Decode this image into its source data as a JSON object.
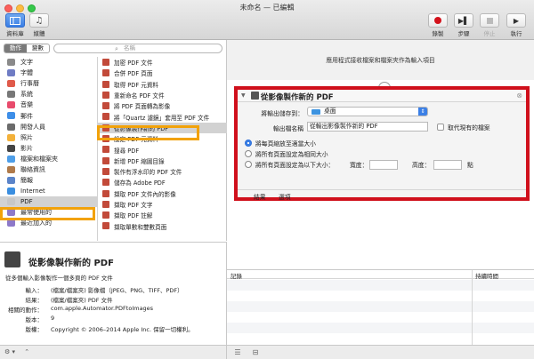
{
  "window": {
    "title": "未命名 — 已編輯"
  },
  "toolbar": {
    "library": "資料庫",
    "media": "媒體",
    "record": "錄製",
    "step": "步驟",
    "stop": "停止",
    "run": "執行"
  },
  "left": {
    "tab_actions": "動作",
    "tab_variables": "變數",
    "search_placeholder": "名稱",
    "categories": [
      {
        "label": "文字",
        "color": "#8a8a8a"
      },
      {
        "label": "字體",
        "color": "#6f7cc4"
      },
      {
        "label": "行事曆",
        "color": "#e05a4a"
      },
      {
        "label": "系統",
        "color": "#777777"
      },
      {
        "label": "音樂",
        "color": "#e84b6c"
      },
      {
        "label": "郵件",
        "color": "#3d8ee8"
      },
      {
        "label": "開發人員",
        "color": "#6b6b6b"
      },
      {
        "label": "照片",
        "color": "#f3b13a"
      },
      {
        "label": "影片",
        "color": "#444444"
      },
      {
        "label": "檔案和檔案夾",
        "color": "#4e9ee8"
      },
      {
        "label": "聯絡資訊",
        "color": "#b07a4a"
      },
      {
        "label": "簡報",
        "color": "#5b84c9"
      },
      {
        "label": "Internet",
        "color": "#3a8ee0"
      },
      {
        "label": "PDF",
        "color": "#c7c7c7"
      },
      {
        "label": "最常使用的",
        "color": "#8d79c9"
      },
      {
        "label": "最近加入的",
        "color": "#8d79c9"
      }
    ],
    "actions": [
      "加密 PDF 文件",
      "合併 PDF 頁面",
      "取得 PDF 元資料",
      "重新命名 PDF 文件",
      "將 PDF 頁面轉為影像",
      "將「Quartz 濾鏡」套用至 PDF 文件",
      "從影像製作新的 PDF",
      "設定 PDF 元資料",
      "搜尋 PDF",
      "新增 PDF 縮圖目錄",
      "製作有浮水印的 PDF 文件",
      "儲存為 Adobe PDF",
      "擷取 PDF 文件內的影像",
      "擷取 PDF 文字",
      "擷取 PDF 註解",
      "擷取單數和雙數頁面"
    ]
  },
  "description": {
    "title": "從影像製作新的 PDF",
    "summary": "從多個輸入影像製作一個多頁的 PDF 文件",
    "rows": [
      {
        "k": "輸入：",
        "v": "(檔案/檔案夾) 影像檔（JPEG、PNG、TIFF、PDF）"
      },
      {
        "k": "結果：",
        "v": "(檔案/檔案夾) PDF 文件"
      },
      {
        "k": "相關的動作：",
        "v": "com.apple.Automator.PDFtoImages"
      },
      {
        "k": "版本：",
        "v": "9"
      },
      {
        "k": "版權：",
        "v": "Copyright © 2006–2014 Apple Inc. 保留一切權利。"
      }
    ]
  },
  "workflow": {
    "hint": "應用程式接收檔案和檔案夾作為輸入項目",
    "action": {
      "title": "從影像製作新的 PDF",
      "save_to_label": "將輸出儲存到：",
      "save_to_value": "桌面",
      "name_label": "輸出檔名稱",
      "name_value": "從輸出影像製作新的 PDF",
      "replace_label": "取代現有的檔案",
      "radio1": "將每頁縮放至適當大小",
      "radio2": "將所有頁面設定為相同大小",
      "radio3": "將所有頁面設定為以下大小：",
      "width_label": "寬度：",
      "height_label": "高度：",
      "unit": "點",
      "tab_results": "結果",
      "tab_options": "選項"
    }
  },
  "log": {
    "col_log": "記錄",
    "col_duration": "持續時間"
  }
}
